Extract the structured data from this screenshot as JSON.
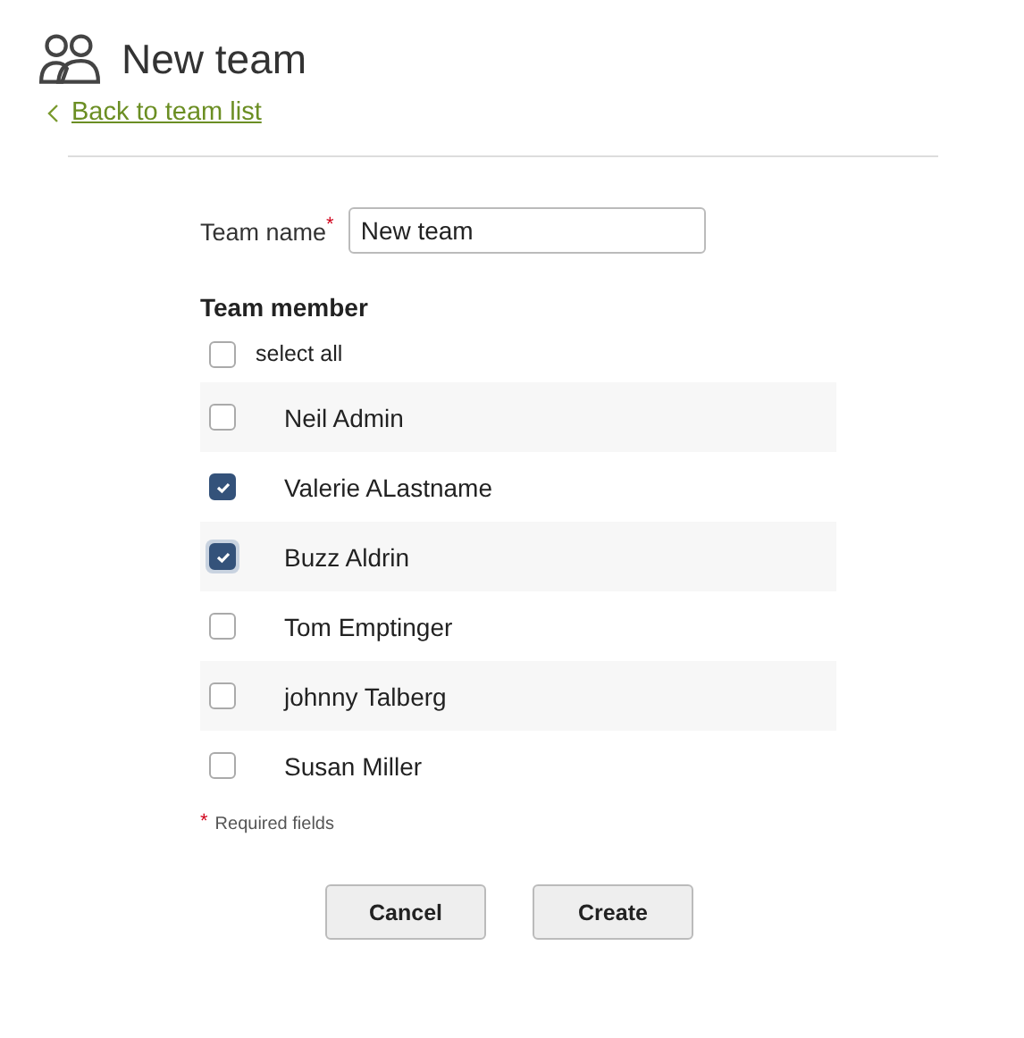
{
  "header": {
    "title": "New team",
    "back_link": "Back to team list"
  },
  "form": {
    "team_name": {
      "label": "Team name",
      "required_mark": "*",
      "value": "New team"
    },
    "members_heading": "Team member",
    "select_all": {
      "label": "select all",
      "checked": false
    },
    "members": [
      {
        "name": "Neil Admin",
        "checked": false,
        "focused": false
      },
      {
        "name": "Valerie ALastname",
        "checked": true,
        "focused": false
      },
      {
        "name": "Buzz Aldrin",
        "checked": true,
        "focused": true
      },
      {
        "name": "Tom Emptinger",
        "checked": false,
        "focused": false
      },
      {
        "name": "johnny Talberg",
        "checked": false,
        "focused": false
      },
      {
        "name": "Susan Miller",
        "checked": false,
        "focused": false
      }
    ],
    "required_note": {
      "mark": "*",
      "text": "Required fields"
    }
  },
  "buttons": [
    "Cancel",
    "Create"
  ]
}
